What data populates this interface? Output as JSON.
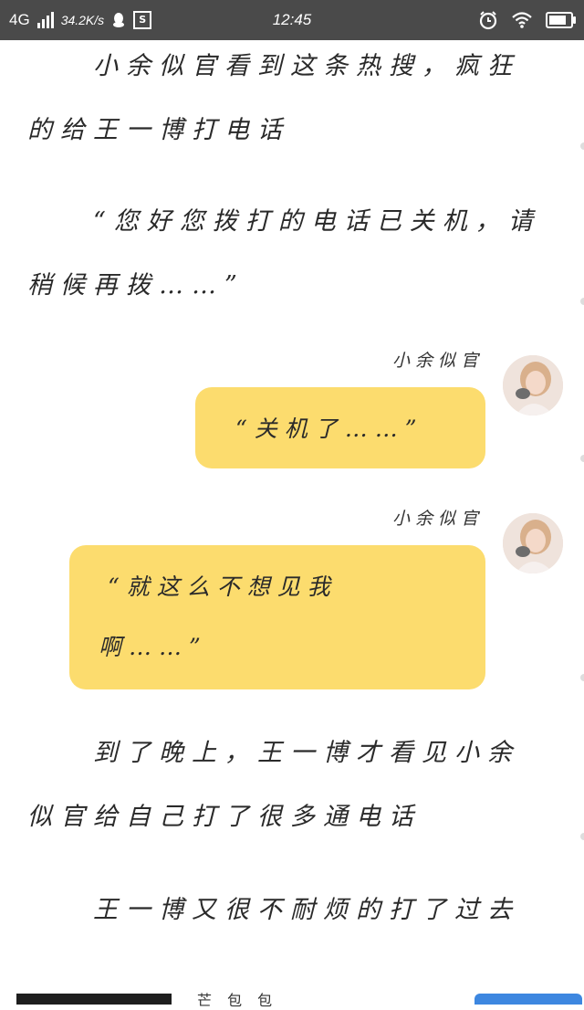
{
  "status_bar": {
    "network": "4G",
    "speed": "34.2K/s",
    "time": "12:45",
    "battery_level": 0.8
  },
  "paragraphs": [
    "　　小余似官看到这条热搜，疯狂的给王一博打电话",
    "　　“您好您拨打的电话已关机，请稍候再拨……”"
  ],
  "messages": [
    {
      "sender": "小余似官",
      "text": "“关机了……”"
    },
    {
      "sender": "小余似官",
      "text_line1": "“就这么不想见我",
      "text_line2": "啊……”"
    }
  ],
  "paragraphs_after": [
    "　　到了晚上，王一博才看见小余似官给自己打了很多通电话",
    "　　王一博又很不耐烦的打了过去"
  ],
  "bottom": {
    "title": "芒 包 包"
  },
  "colors": {
    "status_bar_bg": "#4a4a4a",
    "bubble": "#fcdc6e",
    "button": "#3d87e0"
  }
}
